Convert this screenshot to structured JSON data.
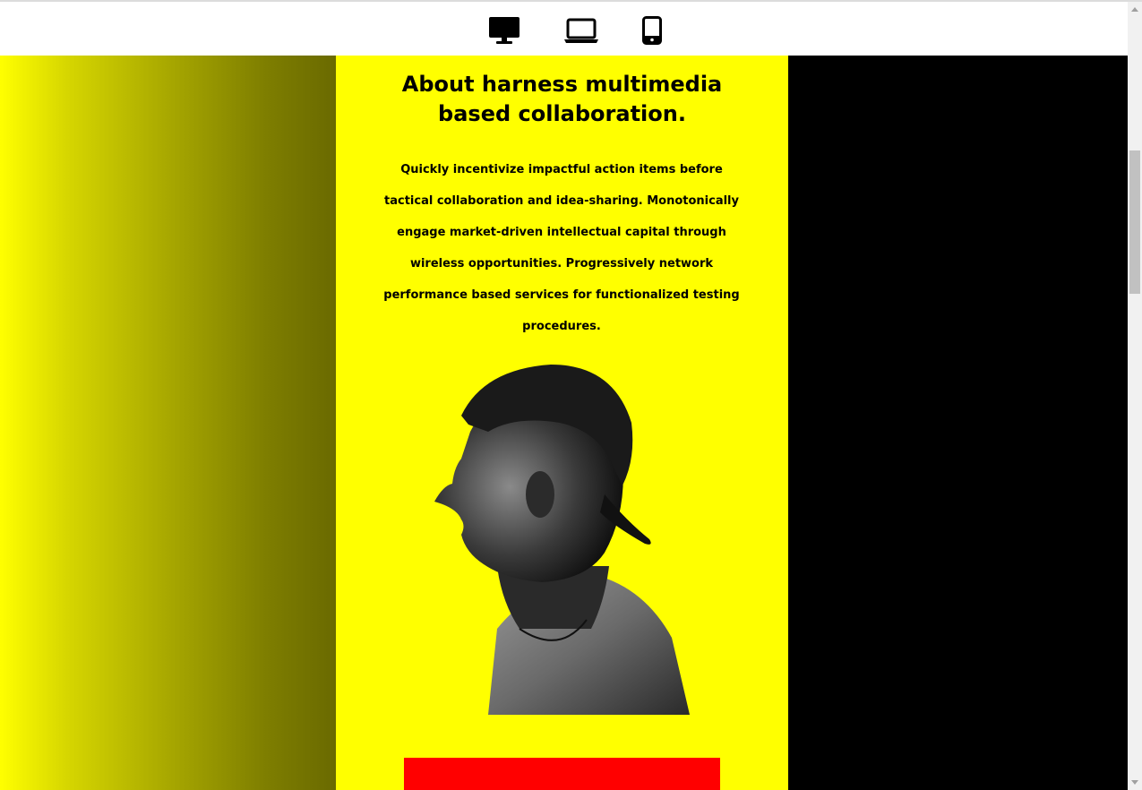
{
  "toolbar": {
    "devices": [
      {
        "name": "desktop",
        "icon": "desktop-icon"
      },
      {
        "name": "laptop",
        "icon": "laptop-icon"
      },
      {
        "name": "tablet",
        "icon": "tablet-icon"
      }
    ]
  },
  "section": {
    "heading_line1": "About harness multimedia",
    "heading_line2": "based collaboration.",
    "body": "Quickly incentivize impactful action items before tactical collaboration and idea-sharing. Monotonically engage market-driven intellectual capital through wireless opportunities. Progressively network performance based services for functionalized testing procedures.",
    "portrait_icon": "person-profile-image"
  },
  "colors": {
    "center_background": "#ffff00",
    "right_background": "#000000",
    "cta_background": "#ff0000",
    "gradient_start": "#ffff00",
    "gradient_end": "#6a6a00"
  }
}
